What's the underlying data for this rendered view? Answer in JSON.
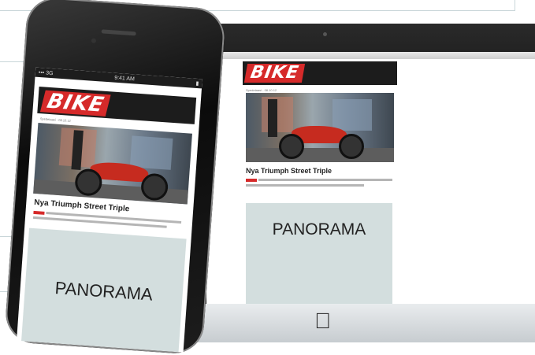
{
  "desktop": {
    "brand": "BIKE",
    "meta": "Spedetaasi - 08.10.12",
    "headline": "Nya Triumph Street Triple",
    "panorama": "PANORAMA"
  },
  "phone": {
    "status": {
      "left": "••• 3G",
      "time": "9:41 AM",
      "right": "▮"
    },
    "brand": "BIKE",
    "meta": "Spedetaasi - 08.10.12",
    "headline": "Nya Triumph Street Triple",
    "panorama": "PANORAMA"
  },
  "colors": {
    "brand_red": "#d62a2a",
    "panorama_bg": "#d3dede"
  },
  "icons": [
    "apple-logo-icon"
  ]
}
